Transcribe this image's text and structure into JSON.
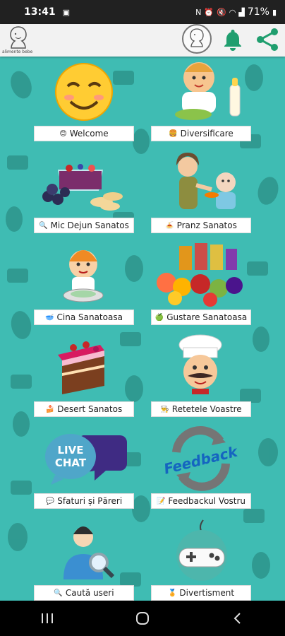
{
  "status": {
    "time": "13:41",
    "battery": "71%"
  },
  "app_bar": {
    "logo_caption": "alimente bebe"
  },
  "tiles": [
    {
      "label": "Welcome",
      "icon": "smile-icon"
    },
    {
      "label": "Diversificare",
      "icon": "burger-icon"
    },
    {
      "label": "Mic Dejun Sanatos",
      "icon": "magnifier-icon"
    },
    {
      "label": "Pranz Sanatos",
      "icon": "plate-icon"
    },
    {
      "label": "Cina Sanatoasa",
      "icon": "bowl-icon"
    },
    {
      "label": "Gustare Sanatoasa",
      "icon": "apple-icon"
    },
    {
      "label": "Desert Sanatos",
      "icon": "cake-icon"
    },
    {
      "label": "Retetele Voastre",
      "icon": "chef-icon"
    },
    {
      "label": "Sfaturi și Păreri",
      "icon": "chat-icon"
    },
    {
      "label": "Feedbackul Vostru",
      "icon": "feedback-icon"
    },
    {
      "label": "Caută useri",
      "icon": "search-icon"
    },
    {
      "label": "Divertisment",
      "icon": "medal-icon"
    }
  ],
  "art_text": {
    "live_chat_line1": "LIVE",
    "live_chat_line2": "CHAT",
    "feedback_word": "Feedback"
  },
  "colors": {
    "background": "#3fbcb3",
    "pattern": "#2b8f86",
    "status_bar": "#212121",
    "app_bar": "#f2f2f2",
    "accent_green": "#1f9e6e"
  }
}
